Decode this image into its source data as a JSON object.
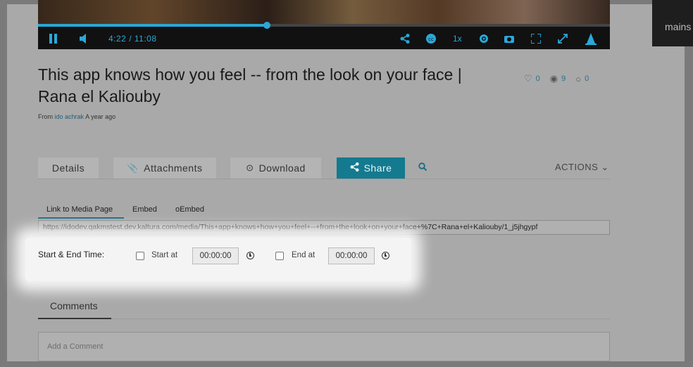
{
  "player": {
    "time": "4:22 / 11:08",
    "progress_percent": 40,
    "speed_label": "1x",
    "accent": "#2aa8d8",
    "icons": [
      "pause-icon",
      "volume-icon",
      "share-icon",
      "closed-captions-icon",
      "settings-icon",
      "camera-icon",
      "fullscreen-icon",
      "expand-icon",
      "logo-icon"
    ]
  },
  "side_panel": {
    "text": "mains"
  },
  "media": {
    "title": "This app knows how you feel -- from the look on your face | Rana el Kaliouby",
    "byline_prefix": "From",
    "author": "ido achrak",
    "age": "A year ago",
    "likes": "0",
    "views": "9",
    "comments_count": "0"
  },
  "tabs": {
    "details": "Details",
    "attachments": "Attachments",
    "download": "Download",
    "share": "Share",
    "actions": "ACTIONS"
  },
  "share": {
    "subtabs": [
      "Link to Media Page",
      "Embed",
      "oEmbed"
    ],
    "url": "https://idodev.qakmstest.dev.kaltura.com/media/This+app+knows+how+you+feel+--+from+the+look+on+your+face+%7C+Rana+el+Kaliouby/1_j5jhgypf",
    "start_end_label": "Start & End Time:",
    "start_label": "Start at",
    "start_value": "00:00:00",
    "end_label": "End at",
    "end_value": "00:00:00"
  },
  "comments": {
    "tab": "Comments",
    "placeholder": "Add a Comment"
  },
  "colors": {
    "share_tab": "#147a8f",
    "link": "#1e5f7a"
  }
}
